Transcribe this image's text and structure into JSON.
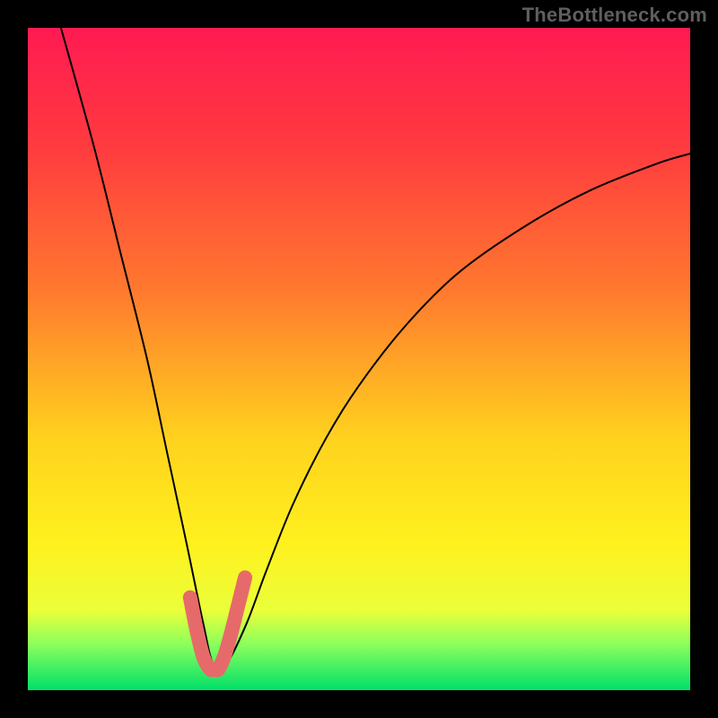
{
  "watermark": "TheBottleneck.com",
  "chart_data": {
    "type": "line",
    "title": "",
    "xlabel": "",
    "ylabel": "",
    "x_range": [
      0,
      100
    ],
    "y_range": [
      0,
      100
    ],
    "gradient_stops": [
      {
        "offset": 0.0,
        "color": "#ff1a52"
      },
      {
        "offset": 0.18,
        "color": "#ff3b3f"
      },
      {
        "offset": 0.4,
        "color": "#ff7a2e"
      },
      {
        "offset": 0.62,
        "color": "#ffd21e"
      },
      {
        "offset": 0.78,
        "color": "#fff11e"
      },
      {
        "offset": 0.88,
        "color": "#eaff3a"
      },
      {
        "offset": 0.93,
        "color": "#8dff5c"
      },
      {
        "offset": 1.0,
        "color": "#00e06a"
      }
    ],
    "series": [
      {
        "name": "bottleneck-curve",
        "x": [
          5,
          10,
          14,
          18,
          21,
          24,
          26.5,
          28,
          30,
          33,
          36,
          40,
          45,
          50,
          57,
          65,
          75,
          85,
          95,
          100
        ],
        "values": [
          100,
          82,
          66,
          50,
          36,
          22,
          10,
          4,
          4,
          10,
          18,
          28,
          38,
          46,
          55,
          63,
          70,
          75.5,
          79.5,
          81
        ]
      }
    ],
    "highlight": {
      "name": "curve-minimum",
      "color": "#e66a6a",
      "stroke_width_px": 16,
      "x": [
        24.5,
        25.5,
        26.5,
        27.5,
        28,
        28.8,
        29.8,
        30.8,
        31.8,
        32.8
      ],
      "values": [
        14,
        9,
        5,
        3.2,
        3.2,
        3.2,
        5.5,
        9,
        13,
        17
      ]
    }
  }
}
